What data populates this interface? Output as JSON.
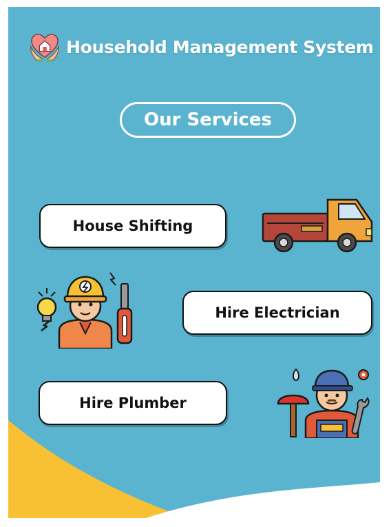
{
  "app": {
    "title": "Household Management System",
    "logo_icon": "home-care-hands-icon"
  },
  "section": {
    "title": "Our Services"
  },
  "services": [
    {
      "label": "House Shifting",
      "icon": "truck-icon"
    },
    {
      "label": "Hire Electrician",
      "icon": "electrician-icon"
    },
    {
      "label": "Hire Plumber",
      "icon": "plumber-icon"
    }
  ],
  "colors": {
    "background": "#5ab4cf",
    "accent_yellow": "#f7c133",
    "button_bg": "#ffffff",
    "text_dark": "#111111"
  }
}
